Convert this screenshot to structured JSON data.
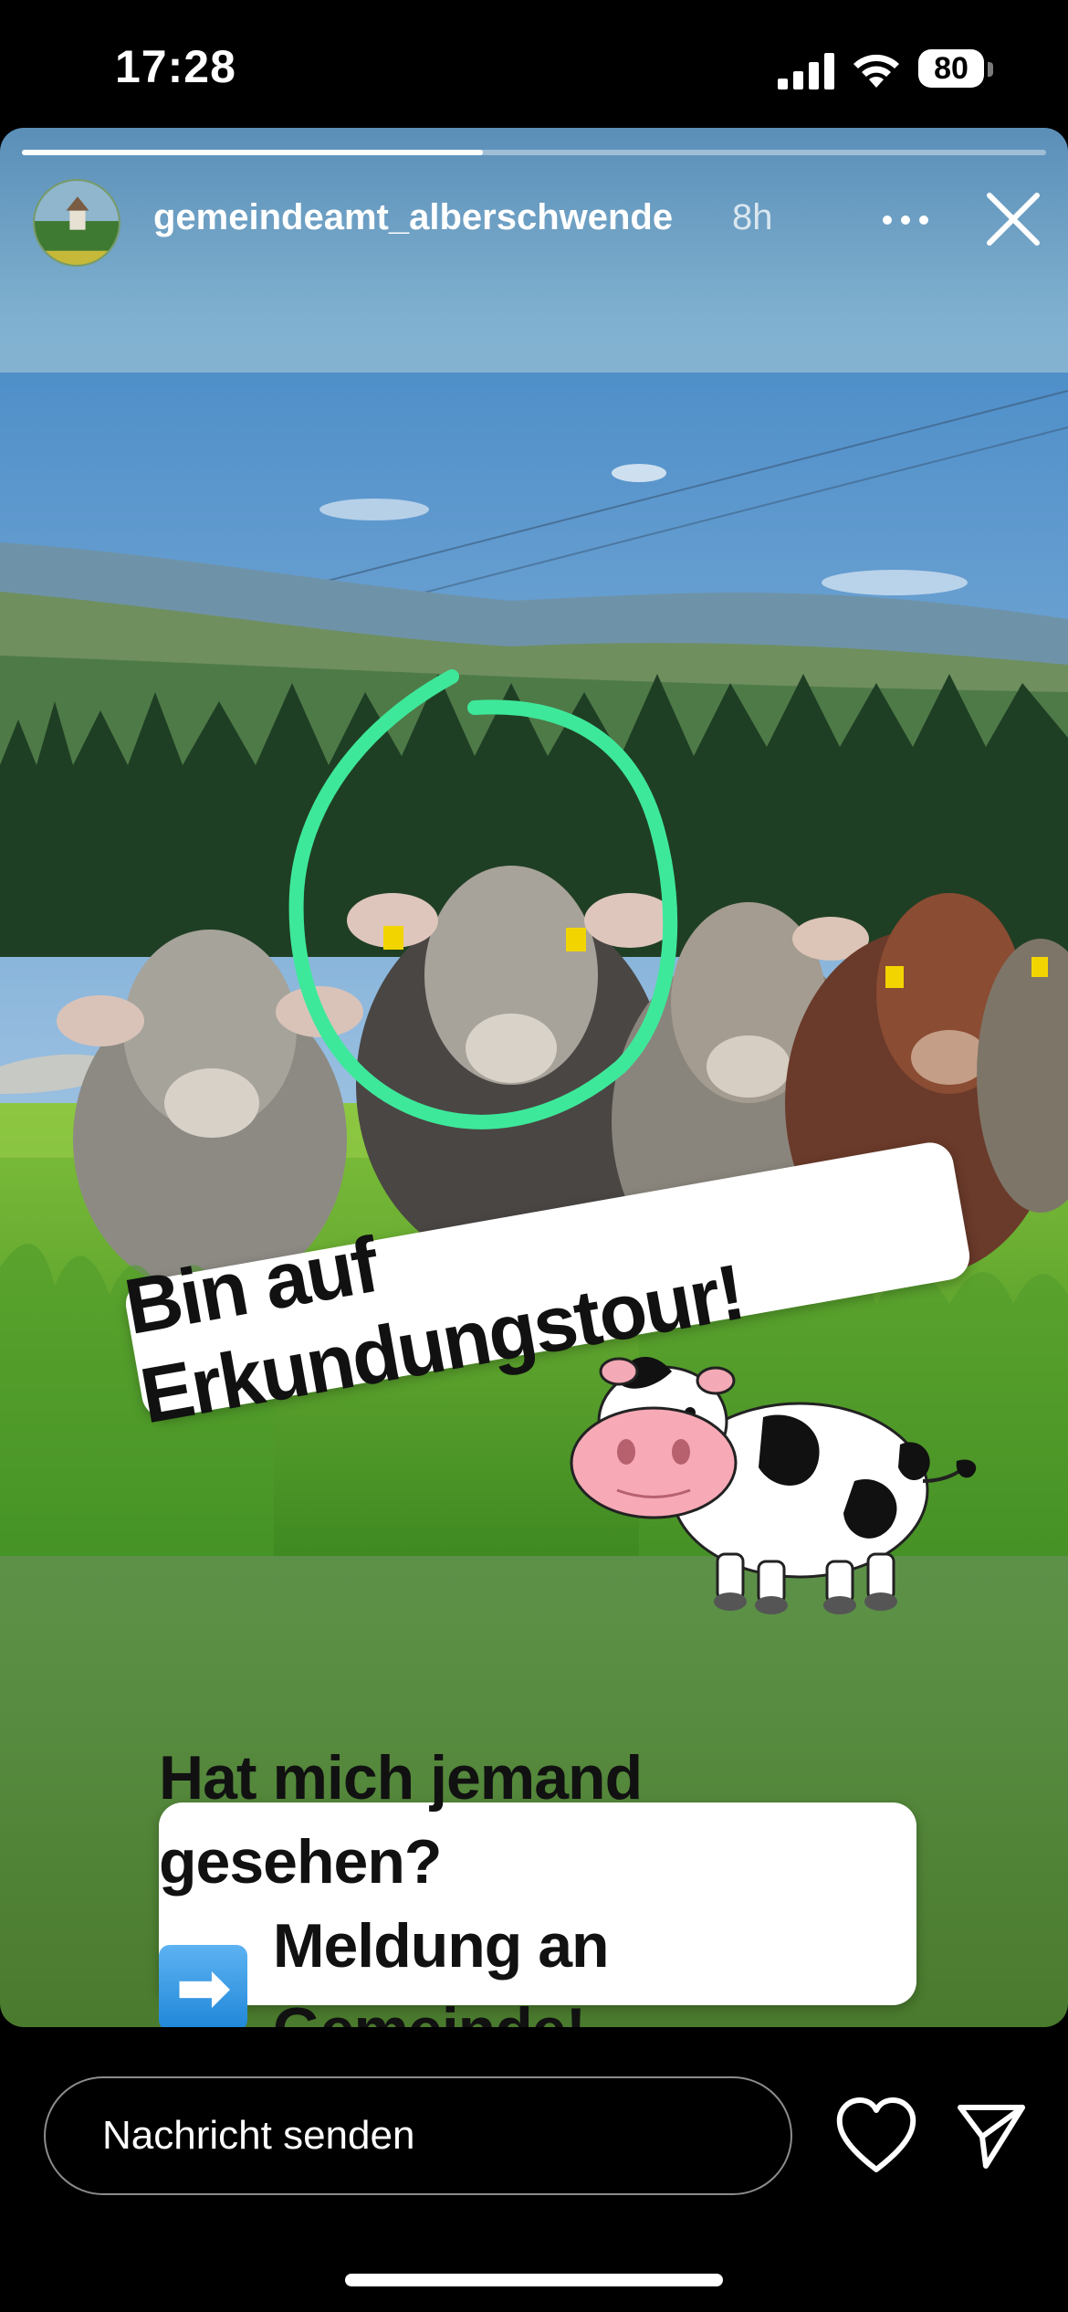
{
  "status_bar": {
    "time": "17:28",
    "battery": "80"
  },
  "story": {
    "progress": 0.45,
    "username": "gemeindeamt_alberschwende",
    "timestamp": "8h",
    "sticker_top": "Bin auf Erkundungstour!",
    "sticker_bottom_line1": "Hat mich jemand gesehen?",
    "sticker_bottom_arrow": "➡",
    "sticker_bottom_line2": "Meldung an Gemeinde!"
  },
  "reply_bar": {
    "placeholder": "Nachricht senden"
  },
  "icons": {
    "more": "ellipsis-icon",
    "close": "close-icon",
    "like": "heart-icon",
    "share": "send-icon"
  },
  "colors": {
    "highlight_circle": "#3ee89a",
    "arrow_emoji": "#2b92e0"
  }
}
